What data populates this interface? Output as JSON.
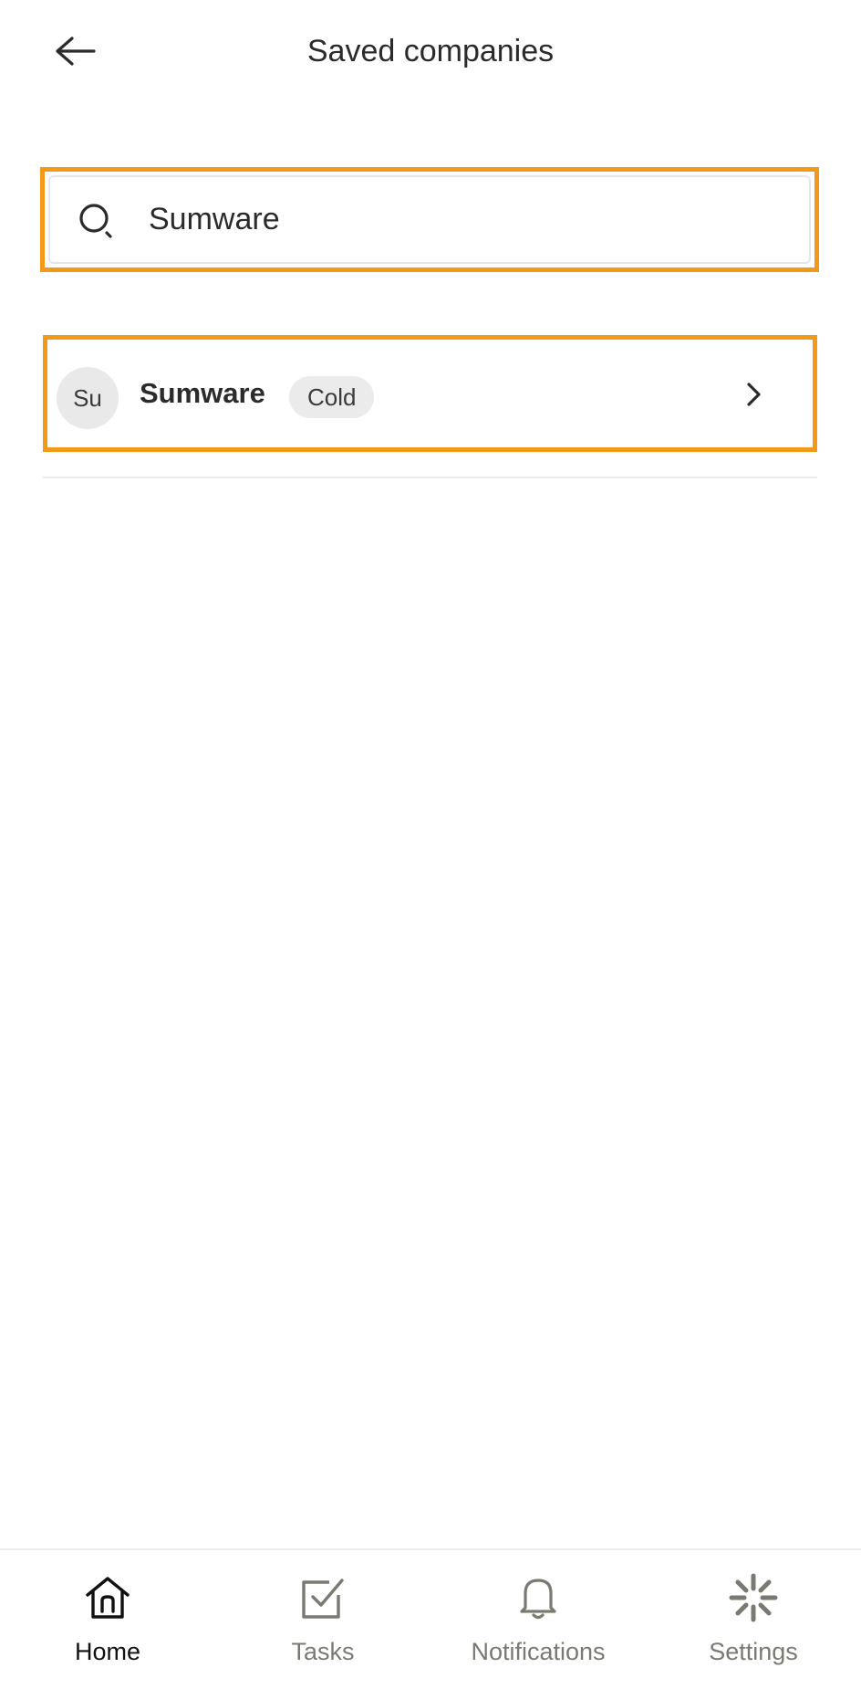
{
  "header": {
    "title": "Saved companies",
    "back_icon": "arrow-left-icon"
  },
  "search": {
    "value": "Sumware",
    "placeholder": "",
    "icon": "search-icon",
    "highlight_color": "#f29a18"
  },
  "results": [
    {
      "avatar_initials": "Su",
      "name": "Sumware",
      "status": "Cold",
      "chevron_icon": "chevron-right-icon"
    }
  ],
  "bottom_nav": {
    "items": [
      {
        "label": "Home",
        "icon": "home-icon",
        "active": true
      },
      {
        "label": "Tasks",
        "icon": "task-check-icon",
        "active": false
      },
      {
        "label": "Notifications",
        "icon": "bell-icon",
        "active": false
      },
      {
        "label": "Settings",
        "icon": "settings-burst-icon",
        "active": false
      }
    ]
  },
  "colors": {
    "accent_highlight": "#f29a18",
    "text_primary": "#2b2b2b",
    "nav_inactive": "#7a7a72",
    "badge_bg": "#ebebeb"
  }
}
